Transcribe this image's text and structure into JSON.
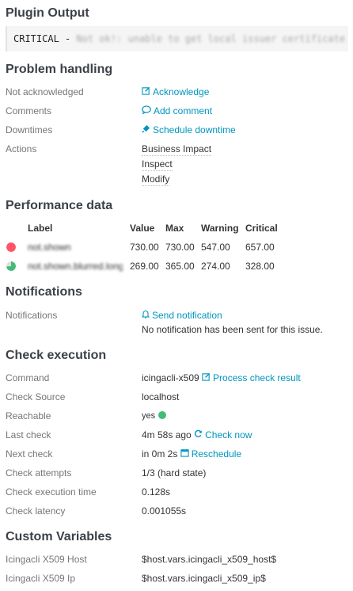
{
  "plugin_output": {
    "heading": "Plugin Output",
    "status": "CRITICAL - ",
    "blurred_text": "Not ok!: unable to get local issuer certificate"
  },
  "problem_handling": {
    "heading": "Problem handling",
    "rows": [
      {
        "label": "Not acknowledged",
        "value": "Acknowledge"
      },
      {
        "label": "Comments",
        "value": "Add comment"
      },
      {
        "label": "Downtimes",
        "value": "Schedule downtime"
      },
      {
        "label": "Actions",
        "actions": [
          "Business Impact",
          "Inspect",
          "Modify"
        ]
      }
    ]
  },
  "performance_data": {
    "heading": "Performance data",
    "columns": [
      "Label",
      "Value",
      "Max",
      "Warning",
      "Critical"
    ],
    "rows": [
      {
        "label": "not.shown",
        "value": "730.00",
        "max": "730.00",
        "warning": "547.00",
        "critical": "657.00",
        "fill": 1.0
      },
      {
        "label": "not.shown.blurred.longer.value",
        "value": "269.00",
        "max": "365.00",
        "warning": "274.00",
        "critical": "328.00",
        "fill": 0.737
      }
    ],
    "colors": {
      "critical": "#ff5566",
      "ok": "#44bb77",
      "empty": "#dddddd"
    }
  },
  "notifications": {
    "heading": "Notifications",
    "label": "Notifications",
    "action": "Send notification",
    "message": "No notification has been sent for this issue."
  },
  "check_execution": {
    "heading": "Check execution",
    "command_label": "Command",
    "command_value": "icingacli-x509",
    "command_action": "Process check result",
    "source_label": "Check Source",
    "source_value": "localhost",
    "reachable_label": "Reachable",
    "reachable_value": "yes",
    "last_label": "Last check",
    "last_value": "4m 58s ago",
    "last_action": "Check now",
    "next_label": "Next check",
    "next_value": "in 0m 2s",
    "next_action": "Reschedule",
    "attempts_label": "Check attempts",
    "attempts_value": "1/3 (hard state)",
    "exec_label": "Check execution time",
    "exec_value": "0.128s",
    "latency_label": "Check latency",
    "latency_value": "0.001055s"
  },
  "custom_variables": {
    "heading": "Custom Variables",
    "rows": [
      {
        "label": "Icingacli X509 Host",
        "value": "$host.vars.icingacli_x509_host$"
      },
      {
        "label": "Icingacli X509 Ip",
        "value": "$host.vars.icingacli_x509_ip$"
      }
    ]
  }
}
